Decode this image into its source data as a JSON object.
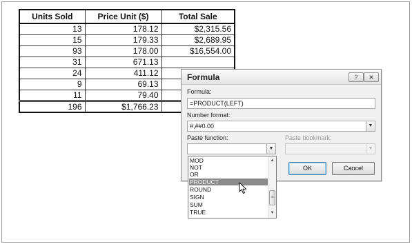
{
  "table": {
    "headers": [
      "Units Sold",
      "Price Unit ($)",
      "Total Sale"
    ],
    "rows": [
      [
        "13",
        "178.12",
        "$2,315.56"
      ],
      [
        "15",
        "179.33",
        "$2,689.95"
      ],
      [
        "93",
        "178.00",
        "$16,554.00"
      ],
      [
        "31",
        "671.13",
        ""
      ],
      [
        "24",
        "411.12",
        ""
      ],
      [
        "9",
        "69.13",
        ""
      ],
      [
        "11",
        "79.40",
        ""
      ]
    ],
    "total": [
      "196",
      "$1,766.23",
      ""
    ]
  },
  "dialog": {
    "title": "Formula",
    "help_label": "?",
    "close_label": "✕",
    "formula_label": "Formula:",
    "formula_value": "=PRODUCT(LEFT)",
    "number_format_label": "Number format:",
    "number_format_value": "#,##0.00",
    "paste_function_label": "Paste function:",
    "paste_function_value": "",
    "paste_bookmark_label": "Paste bookmark:",
    "paste_bookmark_value": "",
    "ok_label": "OK",
    "cancel_label": "Cancel"
  },
  "function_list": {
    "items": [
      "MOD",
      "NOT",
      "OR",
      "PRODUCT",
      "ROUND",
      "SIGN",
      "SUM",
      "TRUE"
    ],
    "selected": "PRODUCT"
  },
  "icons": {
    "dropdown": "chevron-down-icon",
    "scroll_up": "arrow-up-icon",
    "scroll_down": "arrow-down-icon",
    "cursor": "mouse-pointer-icon"
  },
  "colors": {
    "selection": "#8a8a8a",
    "dialog_bg": "#f0f0f0"
  }
}
